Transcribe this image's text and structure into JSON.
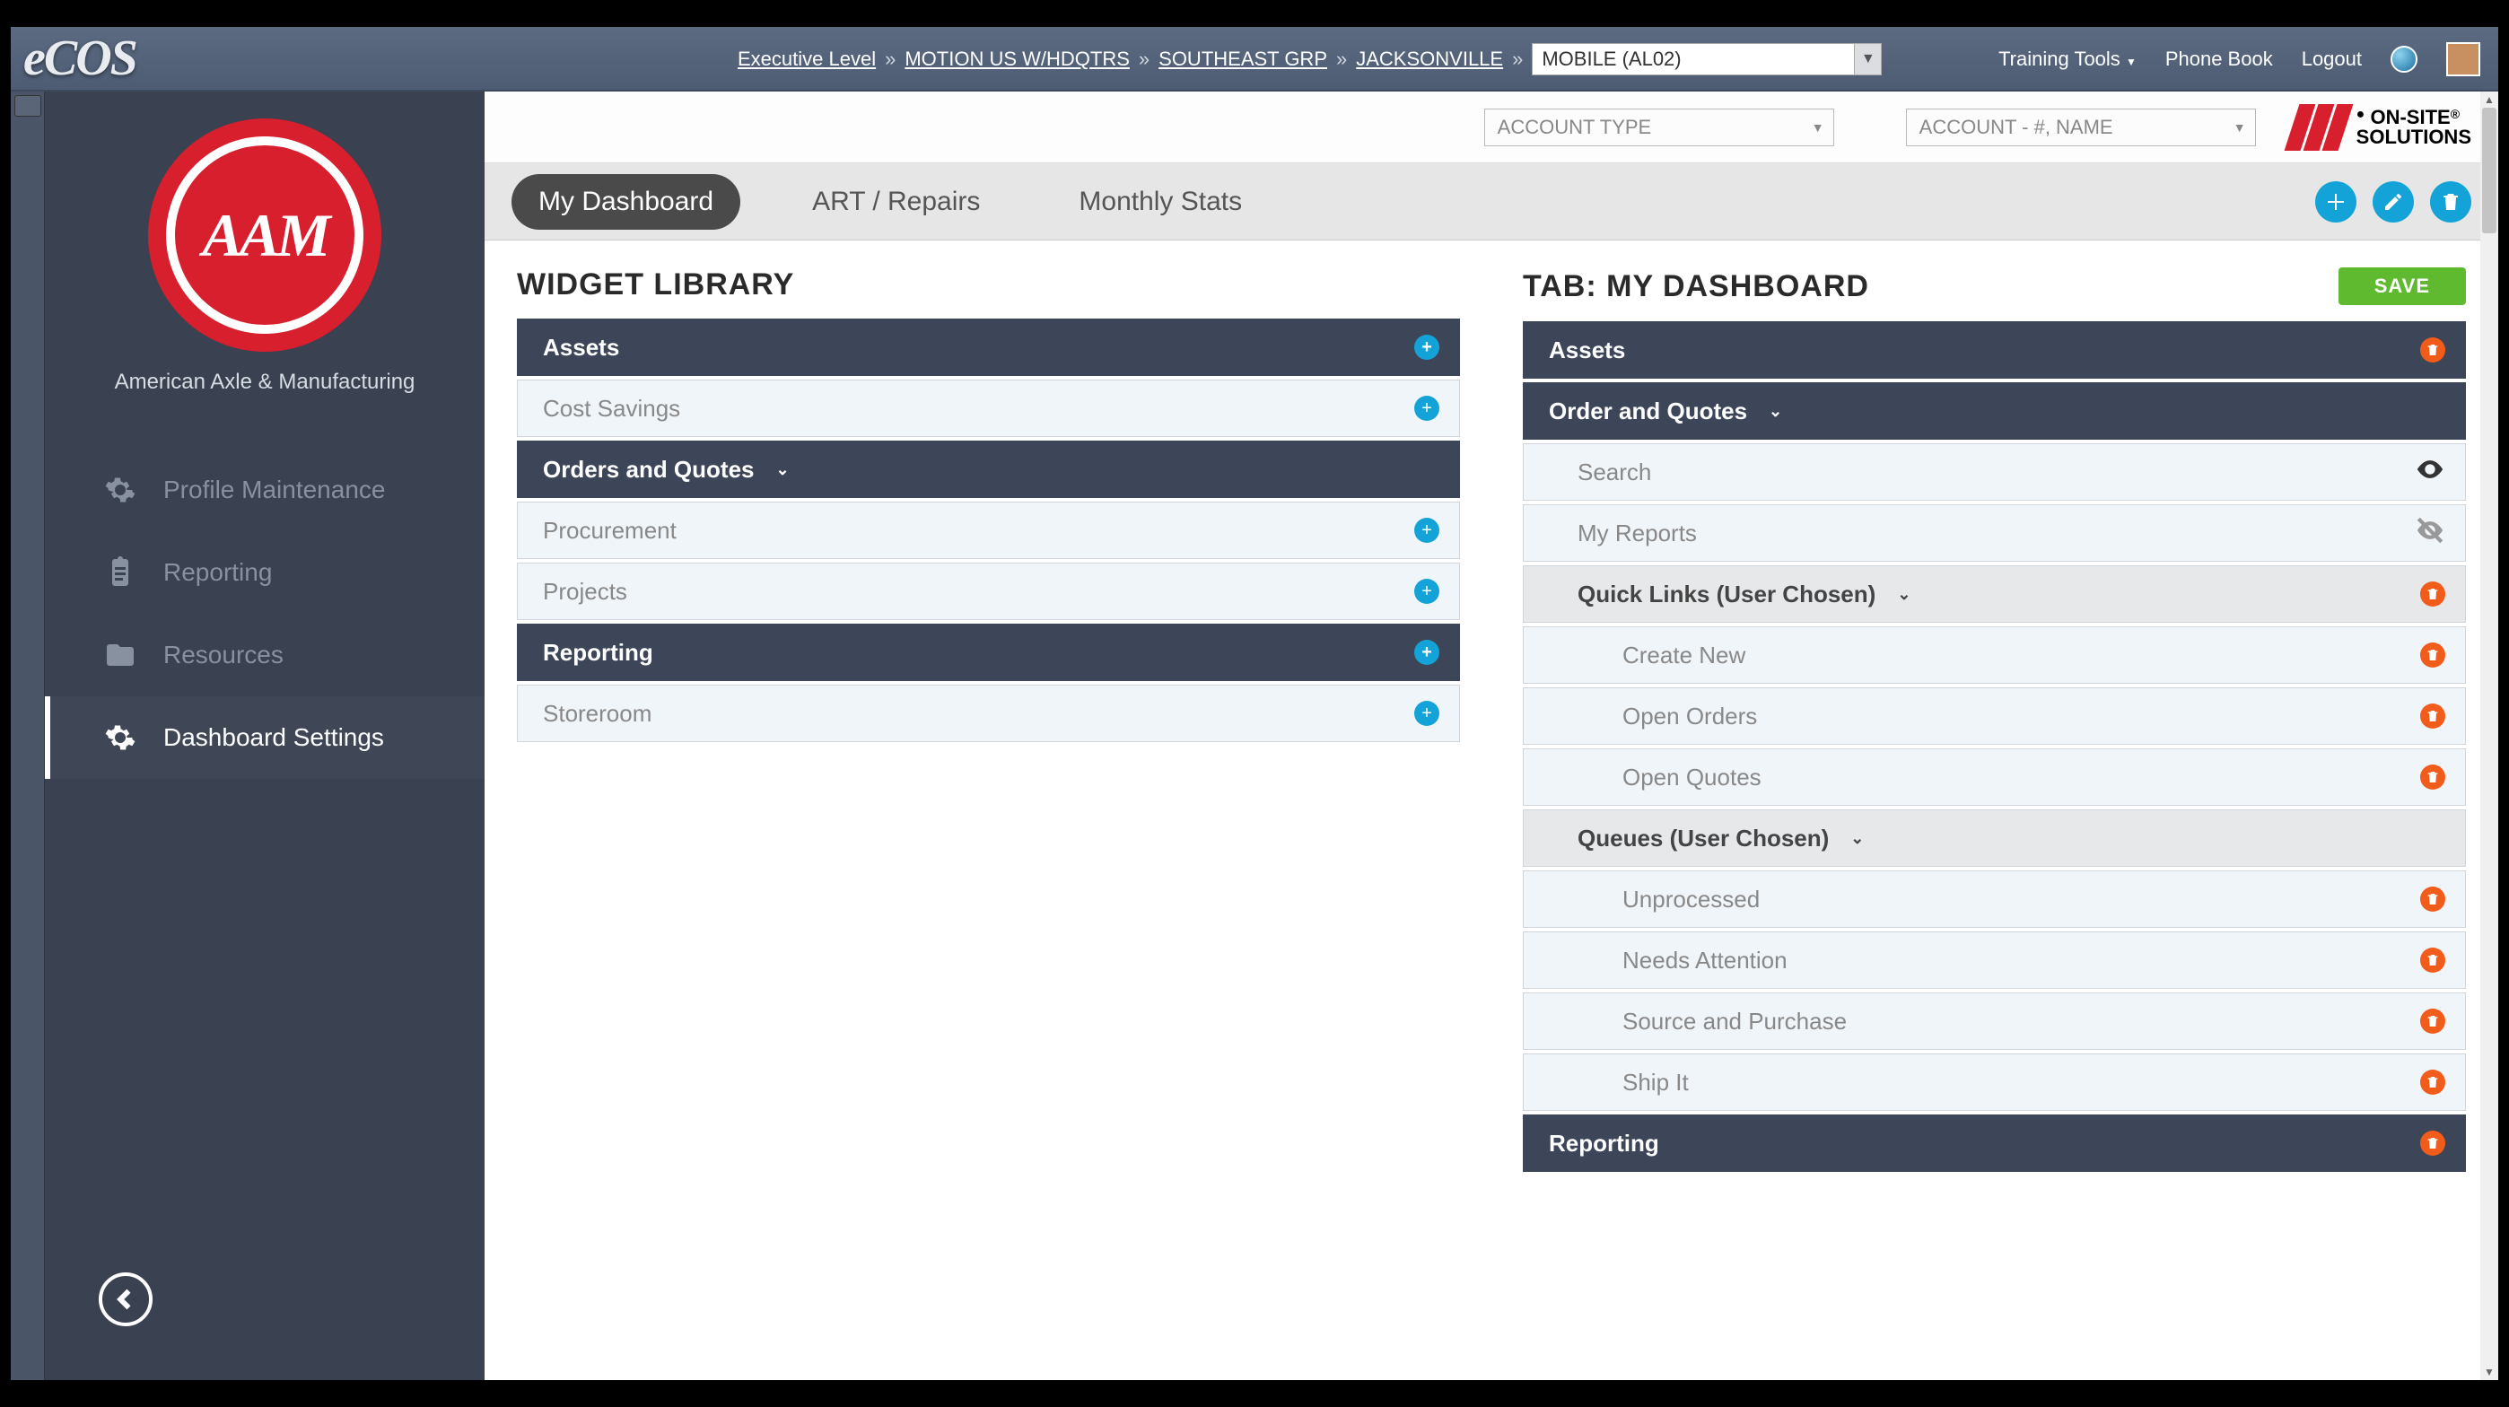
{
  "app": {
    "logo_text": "eCOS"
  },
  "breadcrumb": {
    "items": [
      "Executive Level",
      "MOTION US W/HDQTRS",
      "SOUTHEAST GRP",
      "JACKSONVILLE"
    ],
    "location_selected": "MOBILE (AL02)"
  },
  "topnav": {
    "training_tools": "Training Tools",
    "phone_book": "Phone Book",
    "logout": "Logout"
  },
  "sidebar": {
    "company": "American Axle & Manufacturing",
    "logo_letters": "AAM",
    "items": [
      {
        "label": "Profile Maintenance",
        "icon": "gear"
      },
      {
        "label": "Reporting",
        "icon": "clipboard"
      },
      {
        "label": "Resources",
        "icon": "folder"
      },
      {
        "label": "Dashboard Settings",
        "icon": "gear",
        "active": true
      }
    ]
  },
  "account_bar": {
    "account_type_placeholder": "ACCOUNT TYPE",
    "account_placeholder": "ACCOUNT - #, NAME",
    "onsite_line1": "ON-SITE",
    "onsite_line2": "SOLUTIONS"
  },
  "tabs": {
    "items": [
      "My Dashboard",
      "ART / Repairs",
      "Monthly Stats"
    ],
    "active_index": 0
  },
  "widget_library": {
    "title": "WIDGET LIBRARY",
    "rows": [
      {
        "label": "Assets",
        "style": "dark",
        "action": "plus"
      },
      {
        "label": "Cost Savings",
        "style": "light",
        "action": "plus"
      },
      {
        "label": "Orders and Quotes",
        "style": "dark",
        "action": "chev"
      },
      {
        "label": "Procurement",
        "style": "light",
        "action": "plus"
      },
      {
        "label": "Projects",
        "style": "light",
        "action": "plus"
      },
      {
        "label": "Reporting",
        "style": "dark",
        "action": "plus"
      },
      {
        "label": "Storeroom",
        "style": "light",
        "action": "plus"
      }
    ]
  },
  "tab_panel": {
    "title": "TAB: MY DASHBOARD",
    "save_label": "SAVE",
    "rows": [
      {
        "label": "Assets",
        "style": "dark",
        "action": "del"
      },
      {
        "label": "Order  and Quotes",
        "style": "dark",
        "action": "chev"
      },
      {
        "label": "Search",
        "style": "light",
        "indent": 1,
        "action": "eye"
      },
      {
        "label": "My Reports",
        "style": "light",
        "indent": 1,
        "action": "eye-off"
      },
      {
        "label": "Quick Links (User Chosen)",
        "style": "greyhead",
        "indent": 1,
        "action": "del-chev"
      },
      {
        "label": "Create New",
        "style": "light",
        "indent": 2,
        "action": "del"
      },
      {
        "label": "Open Orders",
        "style": "light",
        "indent": 2,
        "action": "del"
      },
      {
        "label": "Open Quotes",
        "style": "light",
        "indent": 2,
        "action": "del"
      },
      {
        "label": "Queues (User Chosen)",
        "style": "greyhead",
        "indent": 1,
        "action": "chev-only"
      },
      {
        "label": "Unprocessed",
        "style": "light",
        "indent": 2,
        "action": "del"
      },
      {
        "label": "Needs Attention",
        "style": "light",
        "indent": 2,
        "action": "del"
      },
      {
        "label": "Source and Purchase",
        "style": "light",
        "indent": 2,
        "action": "del"
      },
      {
        "label": "Ship It",
        "style": "light",
        "indent": 2,
        "action": "del"
      },
      {
        "label": "Reporting",
        "style": "dark",
        "action": "del"
      }
    ]
  }
}
